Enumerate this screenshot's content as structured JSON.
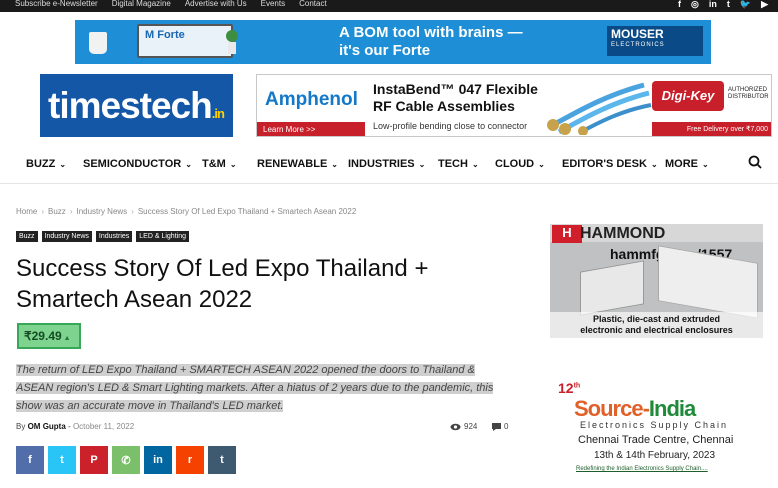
{
  "topbar": {
    "links": [
      "Subscribe e-Newsletter",
      "Digital Magazine",
      "Advertise with Us",
      "Events",
      "Contact"
    ],
    "socials": [
      "f",
      "◎",
      "in",
      "t",
      "🐦",
      "▶"
    ]
  },
  "banner_top": {
    "product_logo": "M Forte",
    "headline_line1": "A BOM tool with brains —",
    "headline_line2": "it's our Forte",
    "brand": "MOUSER",
    "brand_sub": "ELECTRONICS"
  },
  "logo": {
    "main": "timestech",
    "suffix": ".in"
  },
  "ad2": {
    "brand": "Amphenol",
    "learn_more": "Learn More >>",
    "headline_line1": "InstaBend™ 047 Flexible",
    "headline_line2": "RF Cable Assemblies",
    "sub": "Low-profile bending close to connector",
    "distributor": "Digi-Key",
    "authorized": "AUTHORIZED DISTRIBUTOR",
    "delivery": "Free Delivery over ₹7,000"
  },
  "nav": {
    "items": [
      "BUZZ",
      "SEMICONDUCTOR",
      "T&M",
      "RENEWABLE",
      "INDUSTRIES",
      "TECH",
      "CLOUD",
      "EDITOR'S DESK",
      "MORE"
    ]
  },
  "breadcrumbs": [
    "Home",
    "Buzz",
    "Industry News",
    "Success Story Of Led Expo Thailand + Smartech Asean 2022"
  ],
  "tags": [
    "Buzz",
    "Industry News",
    "Industries",
    "LED & Lighting"
  ],
  "article": {
    "title": "Success Story Of Led Expo Thailand + Smartech Asean 2022",
    "price": "₹29.49",
    "excerpt": "The return of LED Expo Thailand + SMARTECH ASEAN 2022 opened the doors to Thailand & ASEAN region's LED & Smart Lighting markets. After a hiatus of 2 years due to the pandemic, this show was an accurate move in Thailand's LED market.",
    "by": "By",
    "author": "OM Gupta",
    "separator": "-",
    "date": "October 11, 2022",
    "views": "924",
    "comments": "0"
  },
  "share": [
    {
      "name": "facebook",
      "glyph": "f",
      "color": "#516eab"
    },
    {
      "name": "twitter",
      "glyph": "t",
      "color": "#29c5f6"
    },
    {
      "name": "pinterest",
      "glyph": "P",
      "color": "#ca212a"
    },
    {
      "name": "whatsapp",
      "glyph": "✆",
      "color": "#7bbf6a"
    },
    {
      "name": "linkedin",
      "glyph": "in",
      "color": "#0266a0"
    },
    {
      "name": "reddit",
      "glyph": "r",
      "color": "#f54200"
    },
    {
      "name": "tumblr",
      "glyph": "t",
      "color": "#3e5a70"
    }
  ],
  "sidebar": {
    "hammond_brand": "HAMMOND",
    "hammond_mark": "H",
    "hammond_url": "hammfg.com/1557",
    "hammond_caption_line1": "Plastic, die-cast and extruded",
    "hammond_caption_line2": "electronic and electrical enclosures",
    "source_num": "12",
    "source_num_sup": "th",
    "source_name_a": "Source",
    "source_name_b": "India",
    "source_sub": "Electronics Supply Chain",
    "source_venue": "Chennai Trade Centre, Chennai",
    "source_dates": "13th & 14th February, 2023",
    "source_tagline": "Redefining the Indian Electronics Supply Chain...."
  },
  "colors": {
    "topbar_bg": "#1a1a1a",
    "brand_blue": "#1457a6",
    "price_green": "#7ed38f"
  }
}
